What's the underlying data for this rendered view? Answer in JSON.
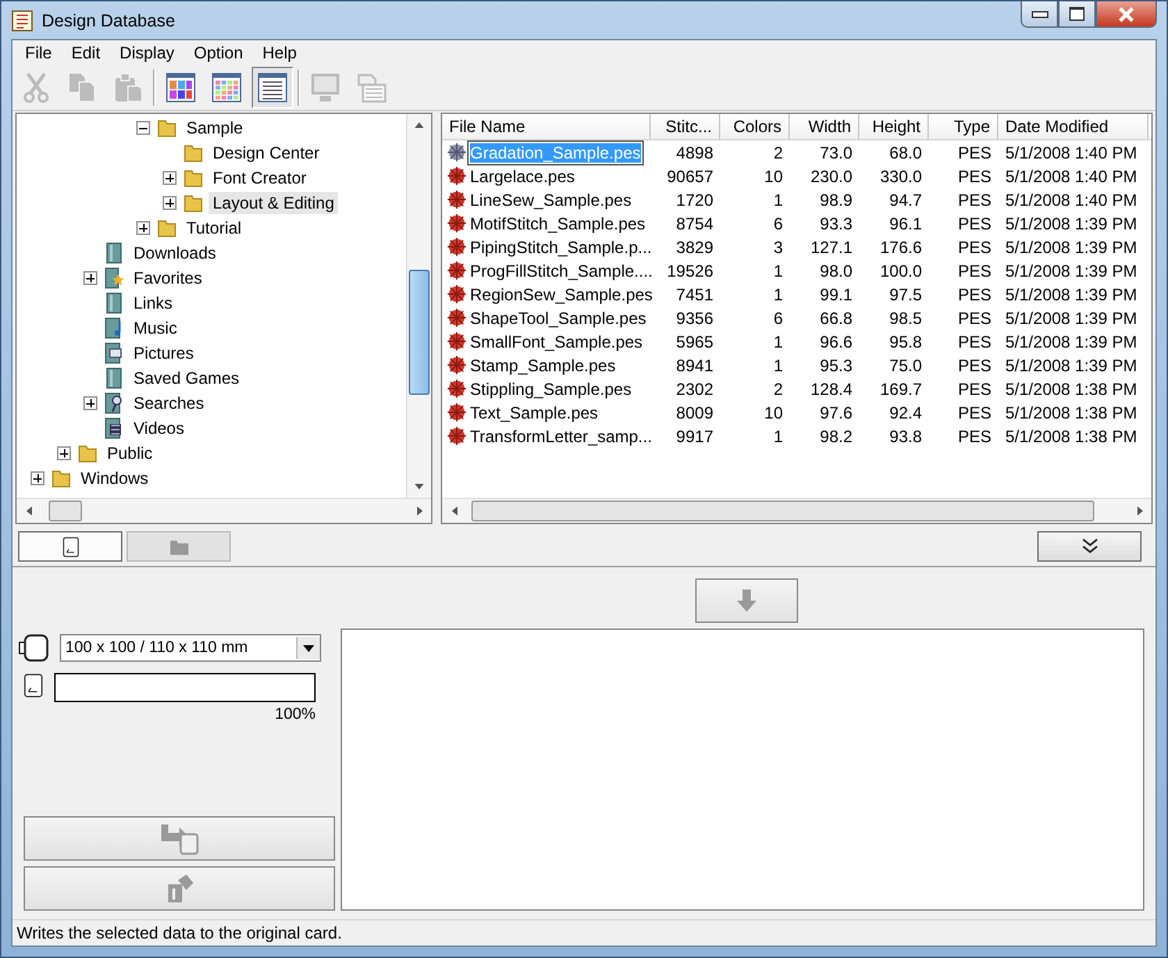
{
  "window": {
    "title": "Design Database"
  },
  "menu": [
    "File",
    "Edit",
    "Display",
    "Option",
    "Help"
  ],
  "toolbar": [
    {
      "kind": "cut",
      "disabled": true,
      "pressed": false
    },
    {
      "kind": "copy",
      "disabled": true,
      "pressed": false
    },
    {
      "kind": "paste",
      "disabled": true,
      "pressed": false
    },
    {
      "kind": "large-view",
      "disabled": false,
      "pressed": false
    },
    {
      "kind": "small-view",
      "disabled": false,
      "pressed": false
    },
    {
      "kind": "details-view",
      "disabled": false,
      "pressed": true
    },
    {
      "kind": "monitor",
      "disabled": true,
      "pressed": false
    },
    {
      "kind": "card",
      "disabled": true,
      "pressed": false
    }
  ],
  "tree": {
    "items": [
      {
        "children": [
          {
            "children": [
              {
                "children": [
                  {
                    "children": [
                      {
                        "label": "Sample",
                        "kind": "folder",
                        "expanded": true,
                        "selected": false,
                        "children": [
                          {
                            "label": "Design Center",
                            "kind": "folder",
                            "selected": false
                          },
                          {
                            "label": "Font Creator",
                            "kind": "folder",
                            "expanded": false,
                            "selected": false
                          },
                          {
                            "label": "Layout & Editing",
                            "kind": "folder",
                            "expanded": false,
                            "selected": true
                          }
                        ]
                      },
                      {
                        "label": "Tutorial",
                        "kind": "folder",
                        "expanded": false,
                        "selected": false
                      }
                    ]
                  }
                ]
              },
              {
                "label": "Downloads",
                "kind": "library",
                "selected": false
              },
              {
                "label": "Favorites",
                "kind": "favorites",
                "expanded": false,
                "selected": false
              },
              {
                "label": "Links",
                "kind": "library",
                "selected": false
              },
              {
                "label": "Music",
                "kind": "music",
                "selected": false
              },
              {
                "label": "Pictures",
                "kind": "pictures",
                "selected": false
              },
              {
                "label": "Saved Games",
                "kind": "library",
                "selected": false
              },
              {
                "label": "Searches",
                "kind": "searches",
                "expanded": false,
                "selected": false
              },
              {
                "label": "Videos",
                "kind": "videos",
                "selected": false
              }
            ]
          },
          {
            "label": "Public",
            "kind": "folder",
            "expanded": false,
            "selected": false
          }
        ]
      },
      {
        "label": "Windows",
        "kind": "folder",
        "expanded": false,
        "selected": false
      }
    ]
  },
  "table": {
    "columns": [
      {
        "label": "File Name"
      },
      {
        "label": "Stitc..."
      },
      {
        "label": "Colors"
      },
      {
        "label": "Width"
      },
      {
        "label": "Height"
      },
      {
        "label": "Type"
      },
      {
        "label": "Date Modified"
      }
    ],
    "rows": [
      {
        "selected": true,
        "cells": [
          "Gradation_Sample.pes",
          "4898",
          "2",
          "73.0",
          "68.0",
          "PES",
          "5/1/2008 1:40 PM"
        ]
      },
      {
        "selected": false,
        "cells": [
          "Largelace.pes",
          "90657",
          "10",
          "230.0",
          "330.0",
          "PES",
          "5/1/2008 1:40 PM"
        ]
      },
      {
        "selected": false,
        "cells": [
          "LineSew_Sample.pes",
          "1720",
          "1",
          "98.9",
          "94.7",
          "PES",
          "5/1/2008 1:40 PM"
        ]
      },
      {
        "selected": false,
        "cells": [
          "MotifStitch_Sample.pes",
          "8754",
          "6",
          "93.3",
          "96.1",
          "PES",
          "5/1/2008 1:39 PM"
        ]
      },
      {
        "selected": false,
        "cells": [
          "PipingStitch_Sample.p...",
          "3829",
          "3",
          "127.1",
          "176.6",
          "PES",
          "5/1/2008 1:39 PM"
        ]
      },
      {
        "selected": false,
        "cells": [
          "ProgFillStitch_Sample....",
          "19526",
          "1",
          "98.0",
          "100.0",
          "PES",
          "5/1/2008 1:39 PM"
        ]
      },
      {
        "selected": false,
        "cells": [
          "RegionSew_Sample.pes",
          "7451",
          "1",
          "99.1",
          "97.5",
          "PES",
          "5/1/2008 1:39 PM"
        ]
      },
      {
        "selected": false,
        "cells": [
          "ShapeTool_Sample.pes",
          "9356",
          "6",
          "66.8",
          "98.5",
          "PES",
          "5/1/2008 1:39 PM"
        ]
      },
      {
        "selected": false,
        "cells": [
          "SmallFont_Sample.pes",
          "5965",
          "1",
          "96.6",
          "95.8",
          "PES",
          "5/1/2008 1:39 PM"
        ]
      },
      {
        "selected": false,
        "cells": [
          "Stamp_Sample.pes",
          "8941",
          "1",
          "95.3",
          "75.0",
          "PES",
          "5/1/2008 1:39 PM"
        ]
      },
      {
        "selected": false,
        "cells": [
          "Stippling_Sample.pes",
          "2302",
          "2",
          "128.4",
          "169.7",
          "PES",
          "5/1/2008 1:38 PM"
        ]
      },
      {
        "selected": false,
        "cells": [
          "Text_Sample.pes",
          "8009",
          "10",
          "97.6",
          "92.4",
          "PES",
          "5/1/2008 1:38 PM"
        ]
      },
      {
        "selected": false,
        "cells": [
          "TransformLetter_samp...",
          "9917",
          "1",
          "98.2",
          "93.8",
          "PES",
          "5/1/2008 1:38 PM"
        ]
      }
    ]
  },
  "source_tabs": [
    {
      "kind": "card",
      "selected": true
    },
    {
      "kind": "folder",
      "selected": false
    }
  ],
  "transfer_button": {
    "disabled": true
  },
  "hoop_select": {
    "value": "100 x 100 / 110 x 110 mm"
  },
  "card_capacity": {
    "level": 0,
    "reading": "100%"
  },
  "write_button": {
    "disabled": true
  },
  "delete_button": {
    "disabled": true
  },
  "status_bar": "Writes the selected data to the original card."
}
